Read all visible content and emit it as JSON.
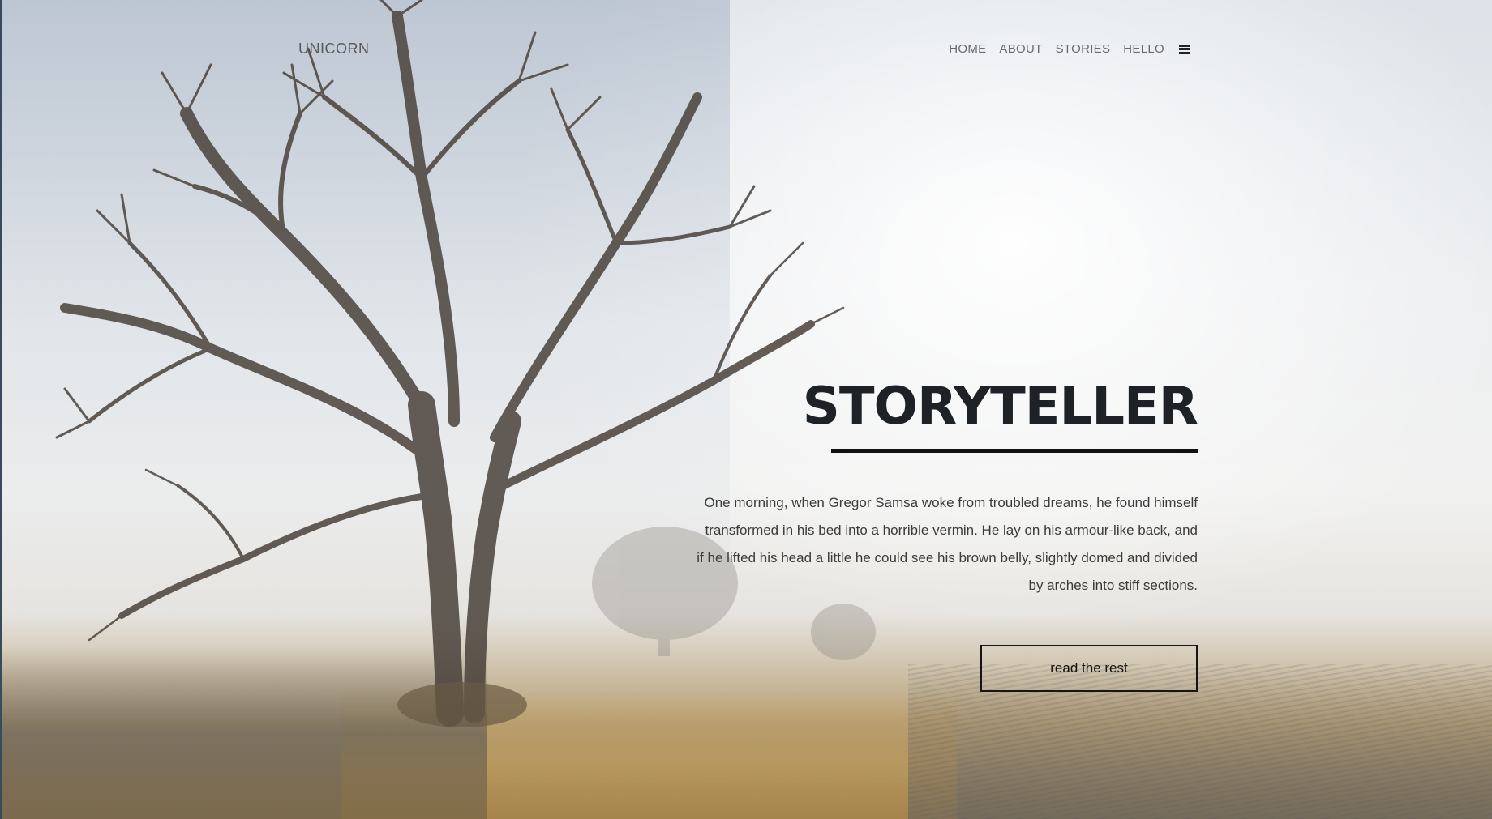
{
  "header": {
    "logo": "UNICORN",
    "nav_items": [
      {
        "label": "HOME"
      },
      {
        "label": "ABOUT"
      },
      {
        "label": "STORIES"
      },
      {
        "label": "HELLO"
      }
    ],
    "menu_icon": "hamburger-menu-icon"
  },
  "hero": {
    "title": "STORYTELLER",
    "description": "One morning, when Gregor Samsa woke from troubled dreams, he found himself transformed in his bed into a horrible vermin. He lay on his armour-like back, and if he lifted his head a little he could see his brown belly, slightly domed and divided by arches into stiff sections.",
    "cta_label": "read the rest",
    "background_image": "foggy-tree-field-photo"
  },
  "colors": {
    "title": "#1e2226",
    "text": "#3b3b3b",
    "nav": "#6a6a6a",
    "rule": "#111111"
  }
}
